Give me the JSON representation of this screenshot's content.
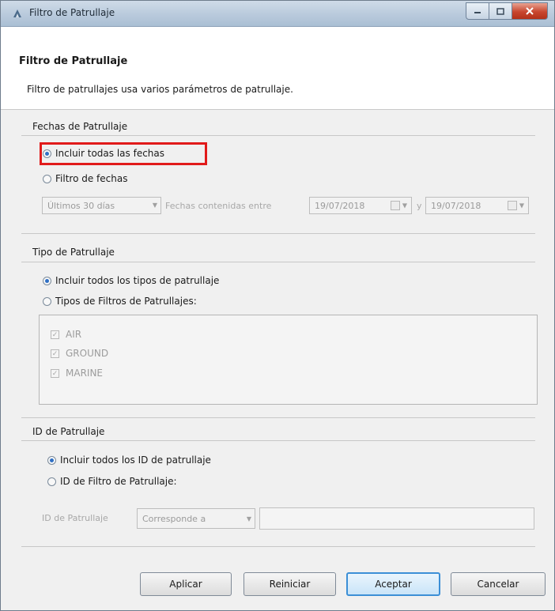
{
  "window": {
    "title": "Filtro de Patrullaje"
  },
  "header": {
    "title": "Filtro de Patrullaje",
    "description": "Filtro de patrullajes usa varios parámetros de patrullaje."
  },
  "dates": {
    "section_title": "Fechas de Patrullaje",
    "option_all": "Incluir todas las fechas",
    "option_filter": "Filtro de fechas",
    "range_value": "Últimos 30 días",
    "between_label": "Fechas contenidas entre",
    "date_from": "19/07/2018",
    "and_label": "y",
    "date_to": "19/07/2018",
    "selected": "all"
  },
  "type": {
    "section_title": "Tipo de Patrullaje",
    "option_all": "Incluir todos los tipos de patrullaje",
    "option_filter": "Tipos de Filtros de Patrullajes:",
    "items": [
      {
        "label": "AIR",
        "checked": true
      },
      {
        "label": "GROUND",
        "checked": true
      },
      {
        "label": "MARINE",
        "checked": true
      }
    ]
  },
  "id": {
    "section_title": "ID de Patrullaje",
    "option_all": "Incluir todos los ID de patrullaje",
    "option_filter": "ID de Filtro de Patrullaje:",
    "field_label": "ID de Patrullaje",
    "match_value": "Corresponde a",
    "text_value": ""
  },
  "buttons": {
    "apply": "Aplicar",
    "reset": "Reiniciar",
    "accept": "Aceptar",
    "cancel": "Cancelar"
  },
  "colors": {
    "highlight": "#e11a1a",
    "default_button": "#3c8fd6",
    "titlebar": "#b9cadc"
  }
}
